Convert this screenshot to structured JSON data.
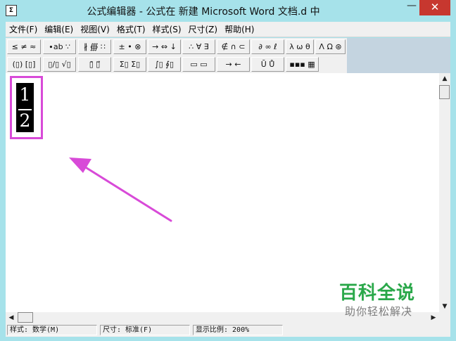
{
  "window": {
    "title": "公式编辑器 - 公式在 新建 Microsoft Word 文档.d 中",
    "app_icon_text": "Σ",
    "minimize_glyph": "—",
    "close_glyph": "✕"
  },
  "menu": [
    "文件(F)",
    "编辑(E)",
    "视图(V)",
    "格式(T)",
    "样式(S)",
    "尺寸(Z)",
    "帮助(H)"
  ],
  "toolbar": {
    "row1": [
      "≤ ≠ ≈",
      "∙ab ∵",
      "∦ ∰ ∷",
      "± • ⊗",
      "→ ⇔ ↓",
      "∴ ∀ ∃",
      "∉ ∩ ⊂",
      "∂ ∞ ℓ",
      "λ ω θ",
      "Λ Ω ⊛"
    ],
    "row2": [
      "(▯) [▯]",
      "▯/▯ √▯",
      "▯̄ ▯⃗",
      "Σ▯ Σ▯",
      "∫▯ ∮▯",
      "▭ ▭",
      "→ ←",
      "Ū Ů",
      "▪▪▪ ▦"
    ]
  },
  "formula": {
    "numerator": "1",
    "denominator": "2"
  },
  "scroll": {
    "up": "▲",
    "down": "▼",
    "left": "◀",
    "right": "▶"
  },
  "status": {
    "style": "样式: 数学(M)",
    "size": "尺寸: 标准(F)",
    "zoom": "显示比例: 200%"
  },
  "watermark": {
    "main": "百科全说",
    "sub": "助你轻松解决"
  },
  "colors": {
    "titlebar": "#a6e2ea",
    "close": "#c7372f",
    "highlight": "#d84ad8",
    "watermark": "#2aa84a"
  }
}
